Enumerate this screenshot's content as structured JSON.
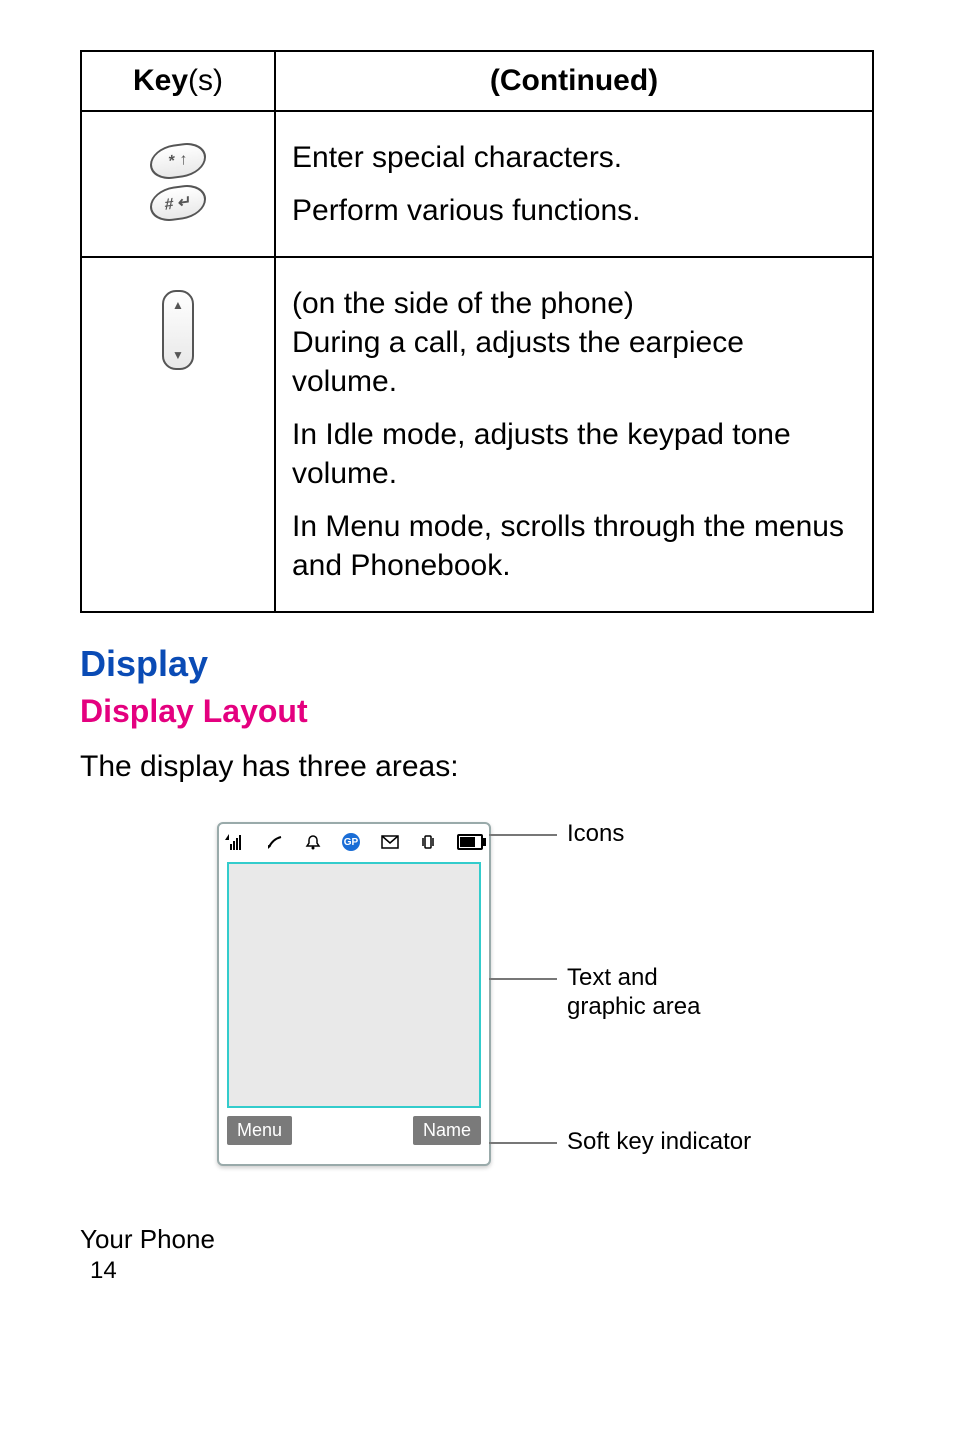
{
  "table": {
    "header_key_bold": "Key",
    "header_key_paren": "(s)",
    "header_continued": "(Continued)",
    "row1": {
      "key_star": "* ↑",
      "key_hash": "# ↵",
      "desc1": "Enter special characters.",
      "desc2": "Perform various functions."
    },
    "row2": {
      "desc1": "(on the side of the phone)",
      "desc2": "During a call, adjusts the earpiece volume.",
      "desc3": "In Idle mode, adjusts the keypad tone volume.",
      "desc4": "In Menu mode, scrolls through the menus and Phonebook."
    }
  },
  "headings": {
    "display": "Display",
    "display_layout": "Display Layout"
  },
  "body": {
    "intro": "The display has three areas:"
  },
  "diagram": {
    "gp_badge": "GP",
    "softkey_left": "Menu",
    "softkey_right": "Name",
    "label_icons": "Icons",
    "label_text_line1": "Text and",
    "label_text_line2": "graphic area",
    "label_softkey": "Soft key indicator"
  },
  "footer": {
    "section": "Your Phone",
    "page": "14"
  }
}
